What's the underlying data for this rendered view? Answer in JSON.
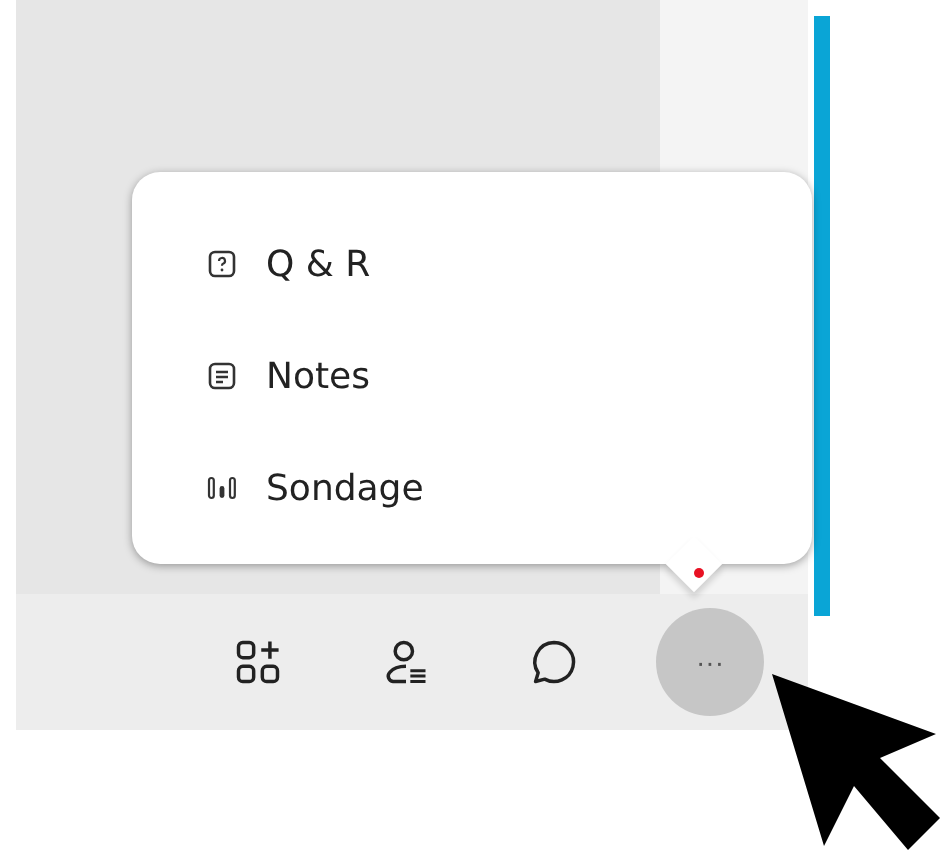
{
  "menu": {
    "items": [
      {
        "kind": "question",
        "label": "Q & R"
      },
      {
        "kind": "notes",
        "label": "Notes"
      },
      {
        "kind": "poll",
        "label": "Sondage"
      }
    ]
  },
  "toolbar": {
    "buttons": [
      {
        "kind": "apps",
        "selected": false
      },
      {
        "kind": "people",
        "selected": false
      },
      {
        "kind": "chat",
        "selected": false
      },
      {
        "kind": "more",
        "label": "···",
        "selected": true,
        "notification": true
      }
    ]
  }
}
